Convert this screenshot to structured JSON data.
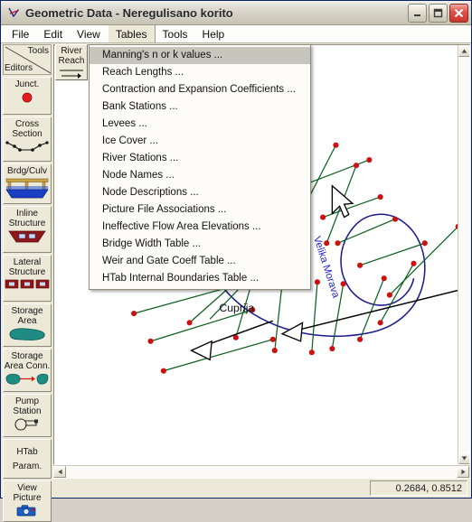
{
  "window": {
    "title": "Geometric Data - Neregulisano korito",
    "title_icon": "cross-section-icon",
    "minimize_label": "_",
    "maximize_label": "□",
    "close_label": "✕",
    "accent_title_color": "#26282b",
    "close_button_color": "#c8362c"
  },
  "menu_bar": {
    "items": [
      {
        "label": "File"
      },
      {
        "label": "Edit"
      },
      {
        "label": "View"
      },
      {
        "label": "Tables"
      },
      {
        "label": "Tools"
      },
      {
        "label": "Help"
      }
    ],
    "open_index": 3
  },
  "tables_menu": {
    "open": true,
    "highlighted_index": 0,
    "items": [
      {
        "label": "Manning's n or k values ..."
      },
      {
        "label": "Reach Lengths ..."
      },
      {
        "label": "Contraction and Expansion Coefficients ..."
      },
      {
        "label": "Bank Stations ..."
      },
      {
        "label": "Levees ..."
      },
      {
        "label": "Ice Cover ..."
      },
      {
        "label": "River Stations ..."
      },
      {
        "label": "Node Names ..."
      },
      {
        "label": "Node Descriptions ..."
      },
      {
        "label": "Picture File Associations ..."
      },
      {
        "label": "Ineffective Flow Area Elevations ..."
      },
      {
        "label": "Bridge Width Table ..."
      },
      {
        "label": "Weir and Gate Coeff Table ..."
      },
      {
        "label": "HTab Internal Boundaries Table ..."
      }
    ]
  },
  "tool_palette": {
    "header": {
      "tools_label": "Tools",
      "editors_label": "Editors"
    },
    "river_reach_button": {
      "line1": "River",
      "line2": "Reach",
      "icon": "arrow-right-icon"
    },
    "buttons": [
      {
        "lines": [
          "Junct."
        ],
        "icon": "junction-dot-icon",
        "color": "#e81c1c"
      },
      {
        "lines": [
          "Cross",
          "Section"
        ],
        "icon": "cross-section-icon",
        "color": "#000000"
      },
      {
        "lines": [
          "Brdg/Culv"
        ],
        "icon": "bridge-culvert-icon",
        "color": "#1b3fc4"
      },
      {
        "lines": [
          "Inline",
          "Structure"
        ],
        "icon": "inline-structure-icon",
        "color": "#8e1616"
      },
      {
        "lines": [
          "Lateral",
          "Structure"
        ],
        "icon": "lateral-structure-icon",
        "color": "#8e1616"
      },
      {
        "lines": [
          "Storage",
          "Area"
        ],
        "icon": "storage-area-icon",
        "color": "#1f8c84"
      },
      {
        "lines": [
          "Storage",
          "Area Conn."
        ],
        "icon": "storage-area-conn-icon",
        "color": "#1f8c84"
      },
      {
        "lines": [
          "Pump",
          "Station"
        ],
        "icon": "pump-station-icon",
        "color": "#2a2a2a"
      },
      {
        "lines": [
          "HTab",
          "Param."
        ],
        "icon": "none",
        "color": "#2a2a2a"
      },
      {
        "lines": [
          "View",
          "Picture"
        ],
        "icon": "camera-icon",
        "color": "#1b5fc4"
      }
    ]
  },
  "schematic": {
    "river_label": "Velika Morava",
    "node_label": "Cuprija",
    "river_color": "#1b1b8f",
    "cross_section_color": "#0b5f1e",
    "node_point_color": "#cc1111",
    "river_label_color": "#2222cc",
    "pointer_arrow_color": "#000000",
    "cursor": "arrow-pointer"
  },
  "scrollbars": {
    "vertical": {
      "up_arrow": "▲",
      "down_arrow": "▼"
    },
    "horizontal": {
      "left_arrow": "◀",
      "right_arrow": "▶"
    }
  },
  "status_bar": {
    "coordinates": "0.2684, 0.8512"
  }
}
